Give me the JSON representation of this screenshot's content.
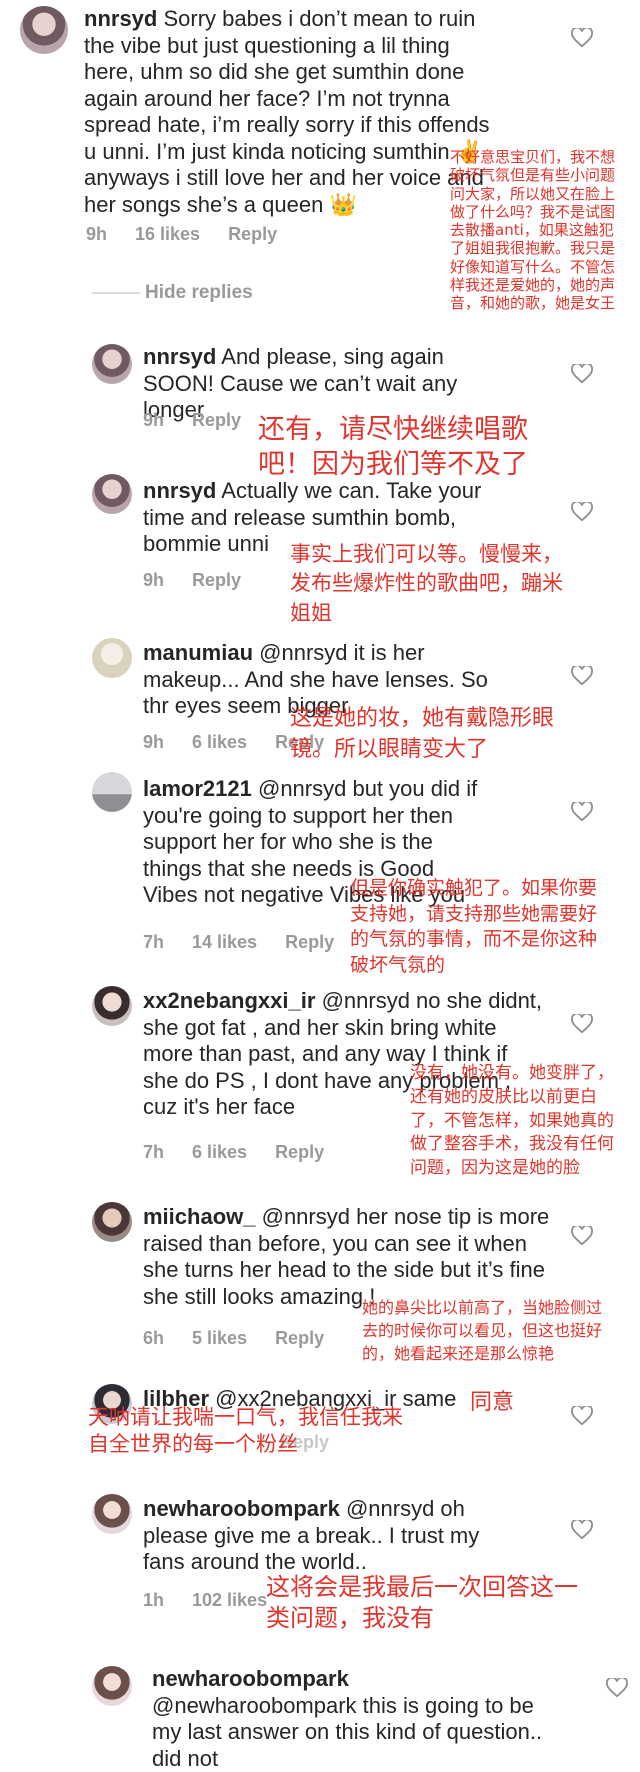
{
  "comments": [
    {
      "user": "nnrsyd",
      "text": "Sorry babes i don’t mean to ruin the vibe but just questioning a lil thing here, uhm so did she get sumthin done again around her face? I’m not trynna spread hate, i’m really sorry if this offends u unni. I’m just kinda noticing sumthin ✌ anyways i still love her and her voice and her songs she’s a queen 👑",
      "time": "9h",
      "likes": "16 likes",
      "reply": "Reply"
    },
    {
      "user": "nnrsyd",
      "text": "And please, sing again SOON! Cause we can’t wait any longer",
      "time": "9h",
      "likes": "",
      "reply": "Reply"
    },
    {
      "user": "nnrsyd",
      "text": "Actually we can. Take your time and release sumthin bomb, bommie unni",
      "time": "9h",
      "likes": "",
      "reply": "Reply"
    },
    {
      "user": "manumiau",
      "text": "@nnrsyd it is her makeup... And she have lenses. So thr eyes seem bigger",
      "time": "9h",
      "likes": "6 likes",
      "reply": "Reply"
    },
    {
      "user": "lamor2121",
      "text": "@nnrsyd but you did if you're going to support her then support her for who she is the things that she needs is Good Vibes not negative Vibes like you",
      "time": "7h",
      "likes": "14 likes",
      "reply": "Reply"
    },
    {
      "user": "xx2nebangxxi_ir",
      "text": "@nnrsyd no she didnt, she got fat , and her skin bring white more than past, and any way I think if she do PS , I dont have any problem , cuz it's her face",
      "time": "7h",
      "likes": "6 likes",
      "reply": "Reply"
    },
    {
      "user": "miichaow_",
      "text": "@nnrsyd her nose tip is more raised than before, you can see it when she turns her head to the side but it’s fine she still looks amazing !",
      "time": "6h",
      "likes": "5 likes",
      "reply": "Reply"
    },
    {
      "user": "lilbher",
      "text": "@xx2nebangxxi_ir same",
      "time": "",
      "likes": "",
      "reply": "Reply"
    },
    {
      "user": "newharoobompark",
      "text": "@nnrsyd oh please give me a break.. I trust my fans around the world..",
      "time": "1h",
      "likes": "102 likes",
      "reply": ""
    },
    {
      "user": "newharoobompark",
      "text": "@newharoobompark this is going to be my last answer on this kind of question.. did not",
      "time": "",
      "likes": "",
      "reply": ""
    }
  ],
  "hide_replies": "Hide replies",
  "translations": [
    "不好意思宝贝们，我不想破坏气氛但是有些小问题问大家，所以她又在脸上做了什么吗？我不是试图去散播anti，如果这触犯了姐姐我很抱歉。我只是好像知道写什么。不管怎样我还是爱她的，她的声音，和她的歌，她是女王",
    "还有，请尽快继续唱歌吧！因为我们等不及了",
    "事实上我们可以等。慢慢来，发布些爆炸性的歌曲吧，蹦米姐姐",
    "这是她的妆，她有戴隐形眼镜。所以眼睛变大了",
    "但是你确实触犯了。如果你要支持她，请支持那些她需要好的气氛的事情，而不是你这种破坏气氛的",
    "没有，她没有。她变胖了，还有她的皮肤比以前更白了，不管怎样，如果她真的做了整容手术，我没有任何问题，因为这是她的脸",
    "她的鼻尖比以前高了，当她脸侧过去的时候你可以看见，但这也挺好的，她看起来还是那么惊艳",
    "天呐请让我喘一口气，我信任我来自全世界的每一个粉丝",
    "同意",
    "这将会是我最后一次回答这一类问题，我没有"
  ]
}
